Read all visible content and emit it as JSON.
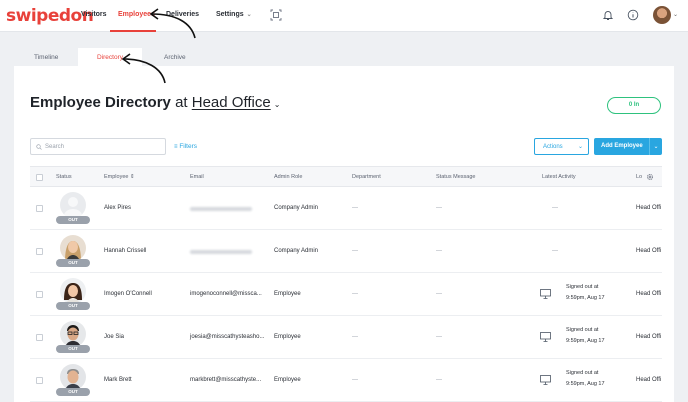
{
  "brand": {
    "logo_text": "swipedon",
    "accent": "#e8413a",
    "link": "#29a6e0",
    "in_color": "#2ec27e"
  },
  "nav": {
    "visitors": "Visitors",
    "employees": "Employees",
    "deliveries": "Deliveries",
    "settings": "Settings"
  },
  "tabs": {
    "timeline": "Timeline",
    "directory": "Directory",
    "archive": "Archive"
  },
  "header": {
    "title": "Employee Directory",
    "at": "at",
    "location": "Head Office",
    "in_count": "0 In"
  },
  "toolbar": {
    "search_placeholder": "Search",
    "filters": "Filters",
    "actions": "Actions",
    "add_employee": "Add Employee"
  },
  "columns": {
    "status": "Status",
    "employee": "Employee",
    "email": "Email",
    "admin_role": "Admin Role",
    "department": "Department",
    "status_message": "Status Message",
    "latest_activity": "Latest Activity",
    "location": "Lo"
  },
  "rows": [
    {
      "name": "Alex Pires",
      "email": "",
      "role": "Company Admin",
      "department": "—",
      "status_message": "—",
      "activity_line1": "",
      "activity_line2": "",
      "activity_dash": "—",
      "location": "Head Offi",
      "status": "OUT",
      "photo": "default"
    },
    {
      "name": "Hannah Crissell",
      "email": "",
      "role": "Company Admin",
      "department": "—",
      "status_message": "—",
      "activity_line1": "",
      "activity_line2": "",
      "activity_dash": "—",
      "location": "Head Offi",
      "status": "OUT",
      "photo": "woman-blonde"
    },
    {
      "name": "Imogen O'Connell",
      "email": "imogenoconnell@missca...",
      "role": "Employee",
      "department": "—",
      "status_message": "—",
      "activity_line1": "Signed out at",
      "activity_line2": "9:59pm, Aug 17",
      "activity_dash": "",
      "location": "Head Offi",
      "status": "OUT",
      "photo": "woman-dark"
    },
    {
      "name": "Joe Sia",
      "email": "joesia@misscathysteasho...",
      "role": "Employee",
      "department": "—",
      "status_message": "—",
      "activity_line1": "Signed out at",
      "activity_line2": "9:59pm, Aug 17",
      "activity_dash": "",
      "location": "Head Offi",
      "status": "OUT",
      "photo": "man-glasses"
    },
    {
      "name": "Mark Brett",
      "email": "markbrett@misscathyste...",
      "role": "Employee",
      "department": "—",
      "status_message": "—",
      "activity_line1": "Signed out at",
      "activity_line2": "9:59pm, Aug 17",
      "activity_dash": "",
      "location": "Head Offi",
      "status": "OUT",
      "photo": "man-grey"
    }
  ]
}
